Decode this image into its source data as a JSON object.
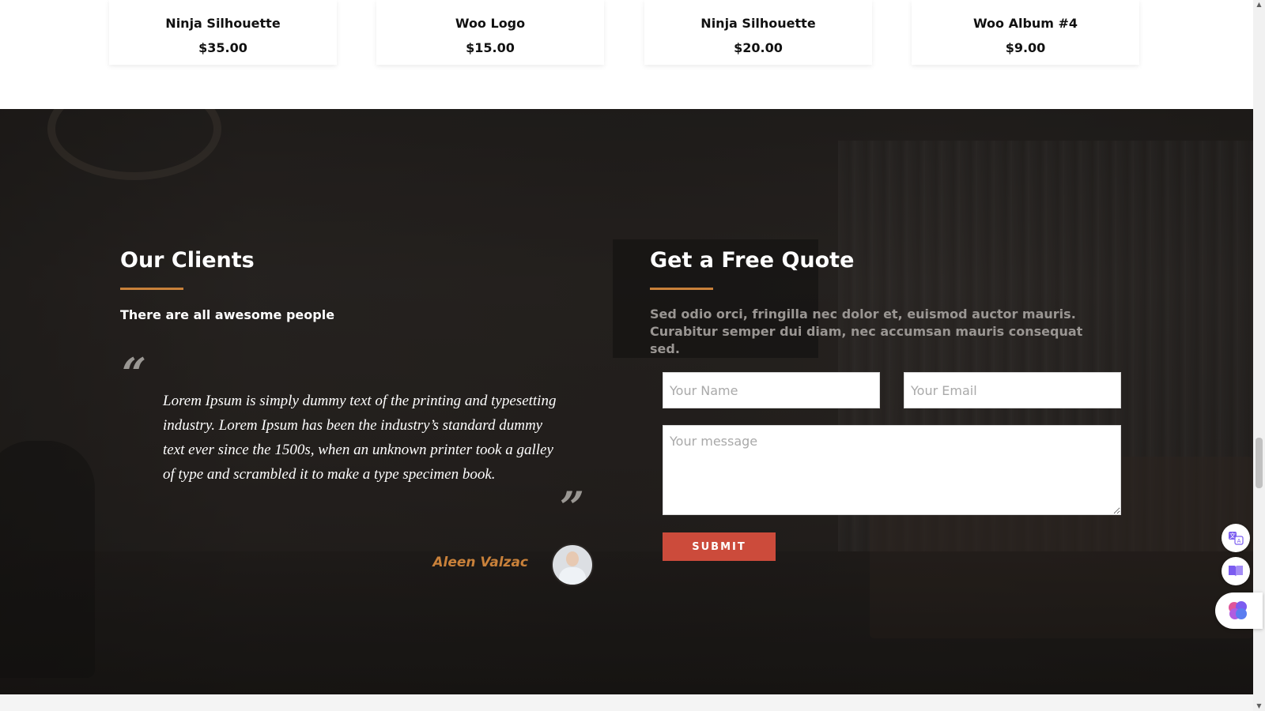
{
  "products": [
    {
      "name": "Ninja Silhouette",
      "price": "$35.00"
    },
    {
      "name": "Woo Logo",
      "price": "$15.00"
    },
    {
      "name": "Ninja Silhouette",
      "price": "$20.00"
    },
    {
      "name": "Woo Album #4",
      "price": "$9.00"
    }
  ],
  "clients": {
    "title": "Our Clients",
    "subtitle": "There are all awesome people",
    "testimonial": "Lorem Ipsum is simply dummy text of the printing and typesetting industry. Lorem Ipsum has been the industry’s standard dummy text ever since the 1500s, when an unknown printer took a galley of type and scrambled it to make a type specimen book.",
    "author": "Aleen Valzac"
  },
  "quote": {
    "title": "Get a Free Quote",
    "intro": "Sed odio orci, fringilla nec dolor et, euismod auctor mauris. Curabitur semper dui diam, nec accumsan mauris consequat sed.",
    "name_placeholder": "Your Name",
    "email_placeholder": "Your Email",
    "message_placeholder": "Your message",
    "submit_label": "SUBMIT"
  },
  "colors": {
    "accent": "#c9813a",
    "submit": "#cc4b3b"
  },
  "icons": {
    "quote_open": "“",
    "quote_close": "”"
  },
  "widgets": [
    "translate-icon",
    "reader-icon",
    "brain-icon"
  ]
}
